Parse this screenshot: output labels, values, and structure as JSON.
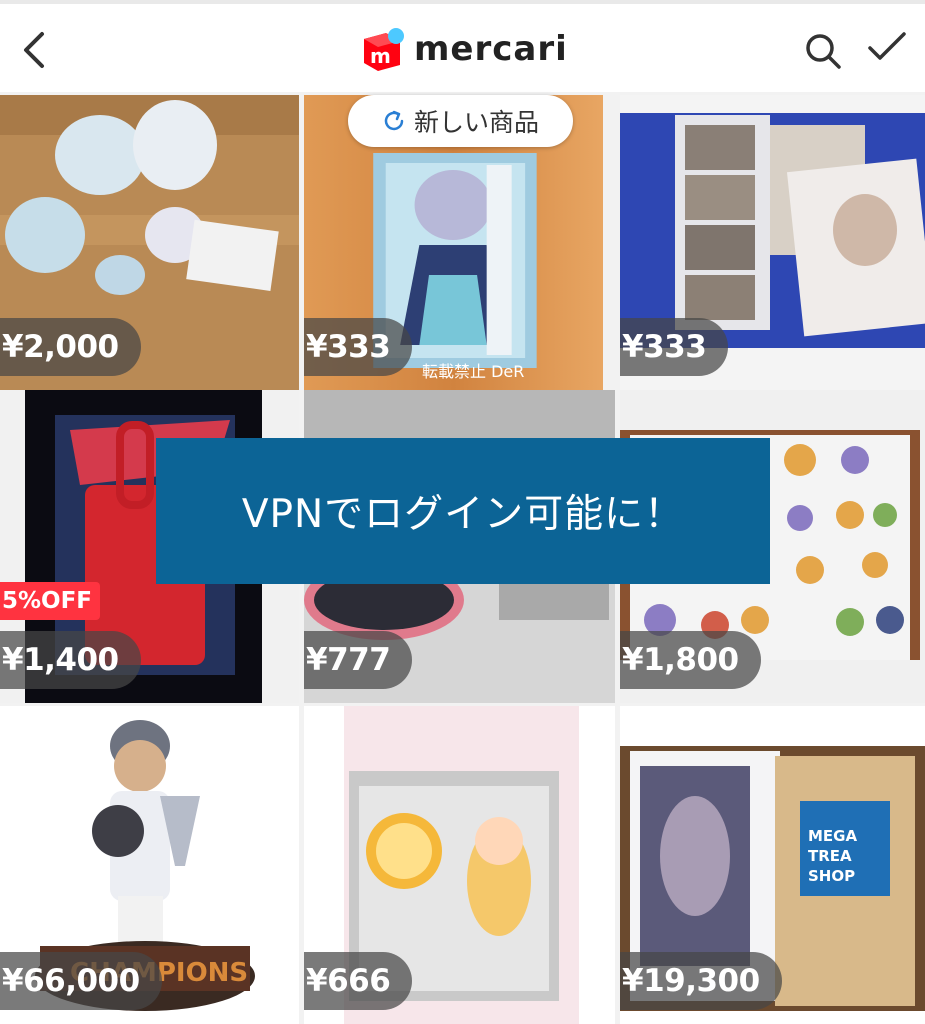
{
  "header": {
    "brand": "mercari",
    "brand_color": "#ff0211",
    "brand_accent_color": "#4dc9ff",
    "back_icon": "chevron-left-icon",
    "search_icon": "search-icon",
    "check_icon": "checkmark-icon"
  },
  "new_items_pill": {
    "label": "新しい商品",
    "icon": "refresh-icon"
  },
  "banner": {
    "text": "VPNでログイン可能に！",
    "bg_color": "#0c6496"
  },
  "items": [
    {
      "price": "¥2,000"
    },
    {
      "price": "¥333",
      "watermark": "転載禁止 DeR"
    },
    {
      "price": "¥333"
    },
    {
      "price": "¥1,400",
      "discount": "5%OFF"
    },
    {
      "price": "¥777"
    },
    {
      "price": "¥1,800"
    },
    {
      "price": "¥66,000"
    },
    {
      "price": "¥666"
    },
    {
      "price": "¥19,300"
    }
  ]
}
